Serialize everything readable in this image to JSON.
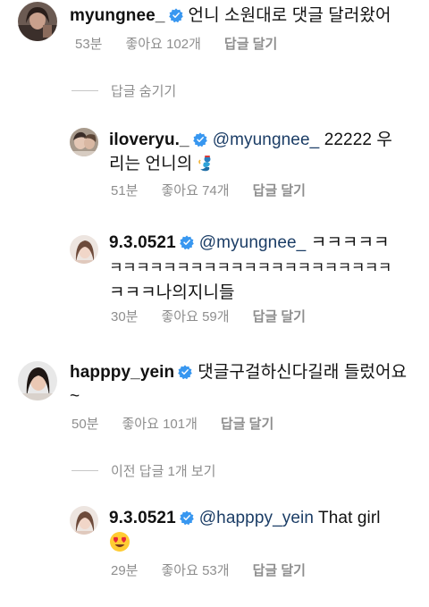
{
  "comments": [
    {
      "username": "myungnee_",
      "text": "언니 소원대로 댓글 달러왔어",
      "time": "53분",
      "likes": "좋아요 102개",
      "reply": "답글 달기"
    },
    {
      "username": "iloveryu._",
      "mention": "@myungnee_",
      "text_line1": " 22222 우",
      "text_line2": "리는 언니의",
      "emoji": "genie-emoji",
      "time": "51분",
      "likes": "좋아요 74개",
      "reply": "답글 달기"
    },
    {
      "username": "9.3.0521",
      "mention": "@myungnee_",
      "text_line1": " ㅋㅋㅋㅋㅋ",
      "text_line2": "ㅋㅋㅋㅋㅋㅋㅋㅋㅋㅋㅋㅋㅋㅋㅋㅋㅋㅋㅋㅋㅋ",
      "text_line3": "ㅋㅋㅋ나의지니들",
      "time": "30분",
      "likes": "좋아요 59개",
      "reply": "답글 달기"
    },
    {
      "username": "happpy_yein",
      "text_line1": "댓글구걸하신다길래 들렀어요",
      "text_line2": "~",
      "time": "50분",
      "likes": "좋아요 101개",
      "reply": "답글 달기"
    },
    {
      "username": "9.3.0521",
      "mention": "@happpy_yein",
      "text_line1": " That girl",
      "emoji": "heart-eyes-emoji",
      "time": "29분",
      "likes": "좋아요 53개",
      "reply": "답글 달기"
    }
  ],
  "threads": {
    "hide_replies": "답글 숨기기",
    "view_previous": "이전 답글 1개 보기"
  },
  "colors": {
    "verified": "#3897f0",
    "meta": "#8e8e8e",
    "mention": "#1b3d66"
  }
}
